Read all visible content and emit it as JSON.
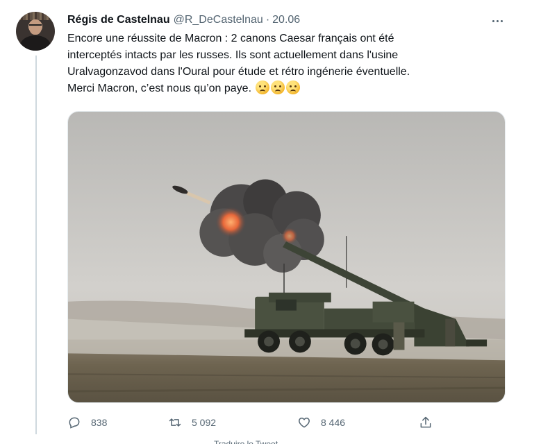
{
  "tweet": {
    "author_name": "Régis de Castelnau",
    "handle": "@R_DeCastelnau",
    "separator": "·",
    "date": "20.06",
    "lines": [
      "Encore une réussite de Macron : 2 canons Caesar français ont été",
      "interceptés intacts par les russes. Ils sont actuellement dans l'usine",
      "Uralvagonzavod dans l'Oural pour étude et rétro ingénerie éventuelle.",
      "Merci Macron, c’est nous qu’on paye."
    ],
    "emojis": [
      "worried-face",
      "worried-face",
      "worried-face"
    ],
    "media": {
      "subject": "Caesar self-propelled howitzer firing"
    }
  },
  "actions": {
    "reply_count": "838",
    "retweet_count": "5 092",
    "like_count": "8 446"
  },
  "footer_text": "Traduire le Tweet"
}
